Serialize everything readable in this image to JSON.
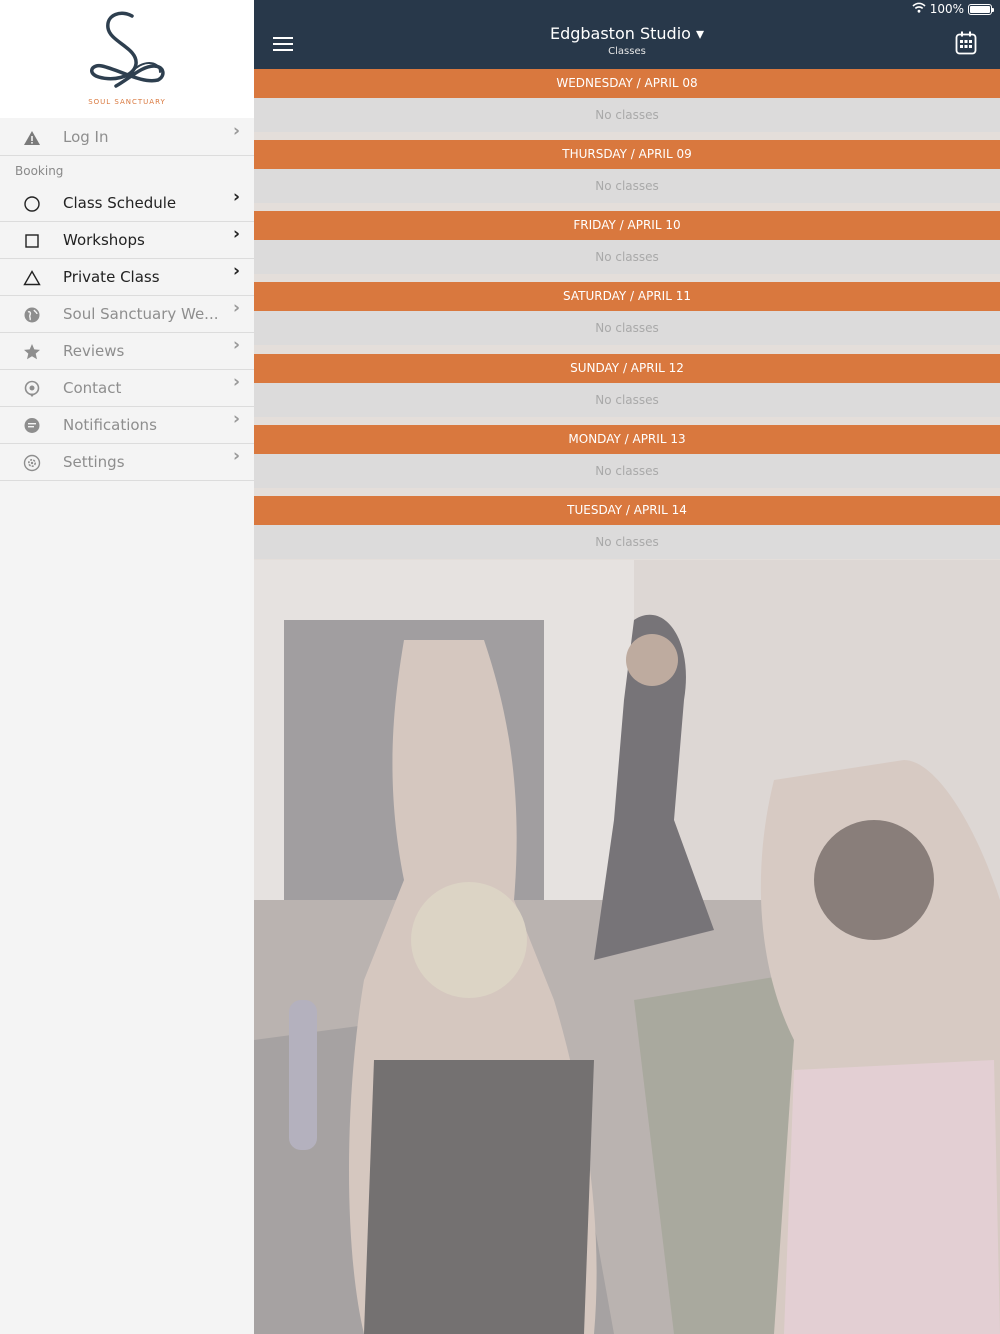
{
  "status_bar": {
    "battery": "100%"
  },
  "brand": {
    "logo_text": "SOUL SANCTUARY"
  },
  "sidebar": {
    "login": {
      "label": "Log In",
      "icon": "warning-icon"
    },
    "section": "Booking",
    "items": [
      {
        "label": "Class Schedule",
        "icon": "circle-icon",
        "style": "dark"
      },
      {
        "label": "Workshops",
        "icon": "square-icon",
        "style": "dark"
      },
      {
        "label": "Private Class",
        "icon": "triangle-icon",
        "style": "dark"
      },
      {
        "label": "Soul Sanctuary We...",
        "icon": "globe-icon",
        "style": "dim"
      },
      {
        "label": "Reviews",
        "icon": "star-icon",
        "style": "dim"
      },
      {
        "label": "Contact",
        "icon": "location-pin-icon",
        "style": "dim"
      },
      {
        "label": "Notifications",
        "icon": "chat-bubble-icon",
        "style": "dim"
      },
      {
        "label": "Settings",
        "icon": "gear-icon",
        "style": "dim"
      }
    ]
  },
  "header": {
    "title": "Edgbaston Studio ▾",
    "subtitle": "Classes"
  },
  "schedule": [
    {
      "day": "WEDNESDAY / APRIL 08",
      "status": "No classes"
    },
    {
      "day": "THURSDAY / APRIL 09",
      "status": "No classes"
    },
    {
      "day": "FRIDAY / APRIL 10",
      "status": "No classes"
    },
    {
      "day": "SATURDAY / APRIL 11",
      "status": "No classes"
    },
    {
      "day": "SUNDAY / APRIL 12",
      "status": "No classes"
    },
    {
      "day": "MONDAY / APRIL 13",
      "status": "No classes"
    },
    {
      "day": "TUESDAY / APRIL 14",
      "status": "No classes"
    }
  ],
  "colors": {
    "accent": "#d9783e",
    "header_bg": "#28384a",
    "logo": "#2e3f4f"
  }
}
